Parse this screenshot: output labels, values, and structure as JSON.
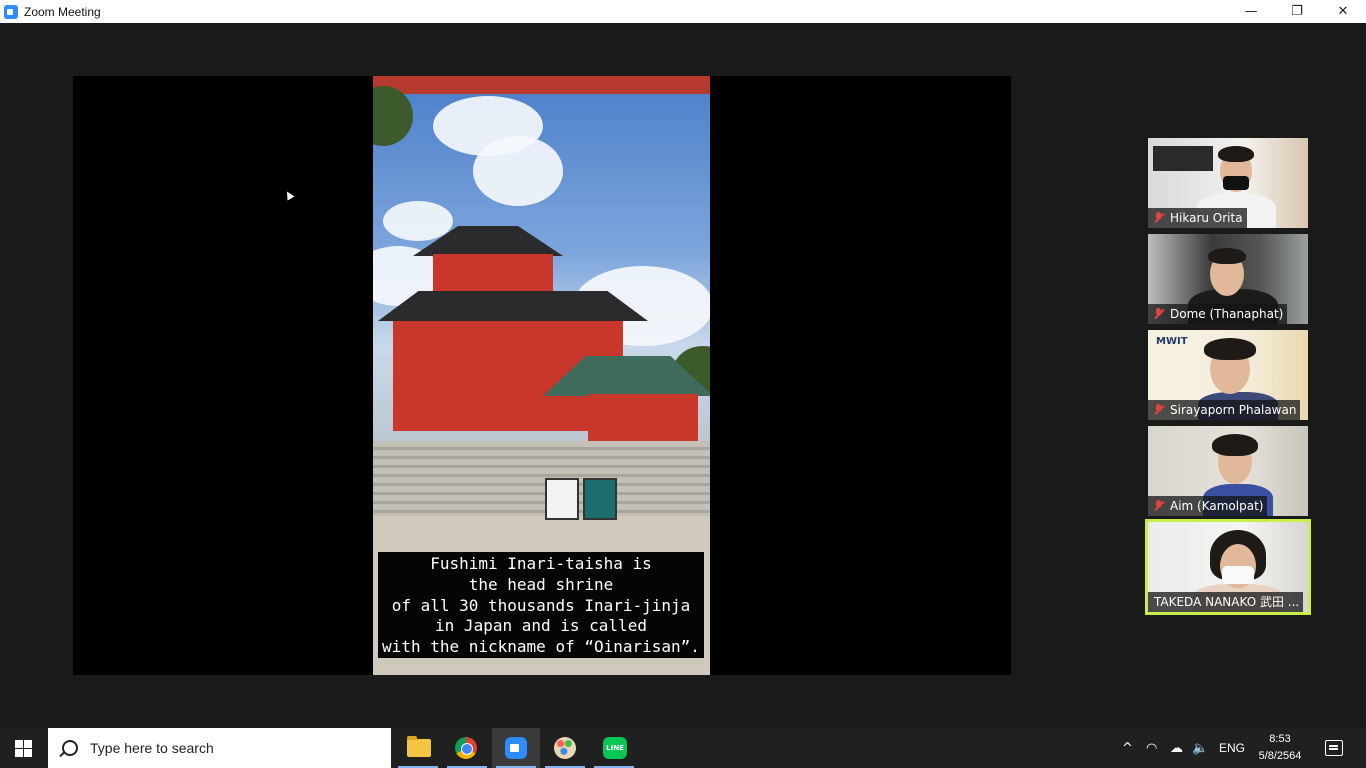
{
  "window": {
    "title": "Zoom Meeting",
    "controls": {
      "minimize": "—",
      "restore": "❐",
      "close": "✕"
    }
  },
  "share": {
    "caption_lines": [
      "Fushimi Inari-taisha is",
      "the head shrine",
      "of all 30 thousands Inari-jinja",
      "in Japan and is called",
      "with the nickname of “Oinarisan”."
    ]
  },
  "participants": [
    {
      "name": "Hikaru Orita",
      "muted": true
    },
    {
      "name": "Dome (Thanaphat)",
      "muted": true
    },
    {
      "name": "Sirayaporn Phalawan",
      "muted": true,
      "logo_text": "MWIT"
    },
    {
      "name": "Aim (Kamolpat)",
      "muted": true
    },
    {
      "name": "TAKEDA NANAKO 武田 ...",
      "muted": false,
      "speaking": true
    }
  ],
  "taskbar": {
    "search_placeholder": "Type here to search",
    "apps": [
      "file-explorer",
      "chrome",
      "zoom",
      "paint",
      "line"
    ],
    "line_label": "LINE",
    "tray": {
      "chevron": "^",
      "language": "ENG"
    },
    "clock": {
      "time": "8:53",
      "date": "5/8/2564"
    }
  },
  "colors": {
    "active_speaker_border": "#c8ef4a",
    "zoom_blue": "#2d8cff",
    "muted_red": "#e0443e"
  }
}
